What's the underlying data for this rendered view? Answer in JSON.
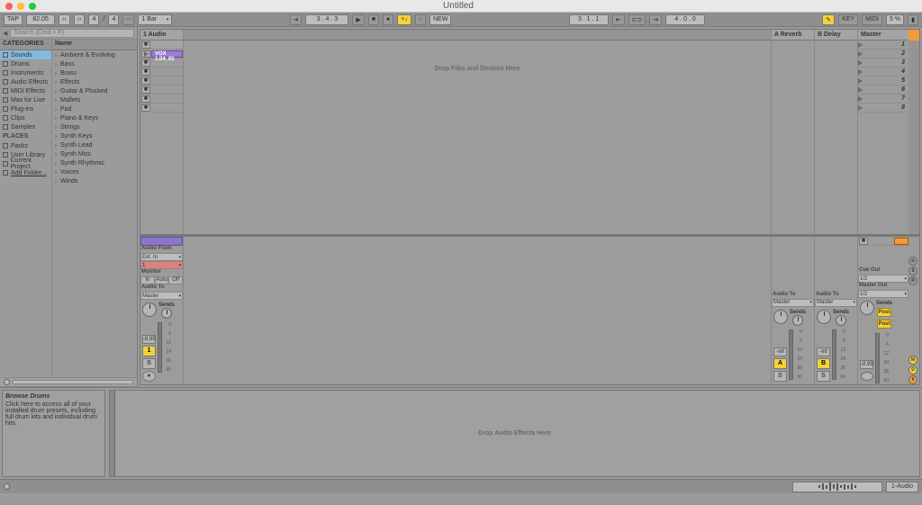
{
  "window": {
    "title": "Untitled"
  },
  "toolbar": {
    "tap": "TAP",
    "bpm": "82.05",
    "sig1": "4",
    "sig2": "4",
    "quant": "1 Bar",
    "pos": "3 .  4 .  3",
    "new_btn": "NEW",
    "loop_pos": "3 .  1 .  1",
    "loop_len": "4 .  0 .  0",
    "key_icon": "/",
    "key": "KEY",
    "midi": "MIDI",
    "cpu": "5 %"
  },
  "browser": {
    "search_placeholder": "Search (Cmd + F)",
    "categories_label": "CATEGORIES",
    "places_label": "PLACES",
    "name_label": "Name",
    "categories": [
      "Sounds",
      "Drums",
      "Instruments",
      "Audio Effects",
      "MIDI Effects",
      "Max for Live",
      "Plug-ins",
      "Clips",
      "Samples"
    ],
    "selected_category_index": 0,
    "places": [
      "Packs",
      "User Library",
      "Current Project",
      "Add Folder..."
    ],
    "names": [
      "Ambient & Evolving",
      "Bass",
      "Brass",
      "Effects",
      "Guitar & Plucked",
      "Mallets",
      "Pad",
      "Piano & Keys",
      "Strings",
      "Synth Keys",
      "Synth Lead",
      "Synth Misc",
      "Synth Rhythmic",
      "Voices",
      "Winds"
    ]
  },
  "session": {
    "track1": "1 Audio",
    "returnA": "A Reverb",
    "returnB": "B Delay",
    "master": "Master",
    "clip1": "VOX 1.04_05",
    "scenes": [
      "1",
      "2",
      "3",
      "4",
      "5",
      "6",
      "7",
      "8"
    ],
    "drop_hint": "Drop Files and Devices Here"
  },
  "mixer": {
    "audio_from": "Audio From",
    "ext_in": "Ext. In",
    "ch": "1",
    "monitor": "Monitor",
    "mon_in": "In",
    "mon_auto": "Auto",
    "mon_off": "Off",
    "audio_to": "Audio To",
    "master": "Master",
    "cue_out": "Cue Out",
    "master_out": "Master Out",
    "out_12": "1/2",
    "sends": "Sends",
    "post": "Post",
    "inf_db": "-8.95",
    "inf": "-inf",
    "trackA": "A",
    "trackB": "B",
    "track1": "1",
    "solo": "S",
    "scale": [
      "0",
      "6",
      "12",
      "24",
      "36",
      "60"
    ]
  },
  "info": {
    "title": "Browse Drums",
    "body": "Click here to access all of your installed drum presets, including full drum kits and individual drum hits."
  },
  "devices": {
    "drop_hint": "Drop Audio Effects Here"
  },
  "status": {
    "track": "1-Audio"
  }
}
